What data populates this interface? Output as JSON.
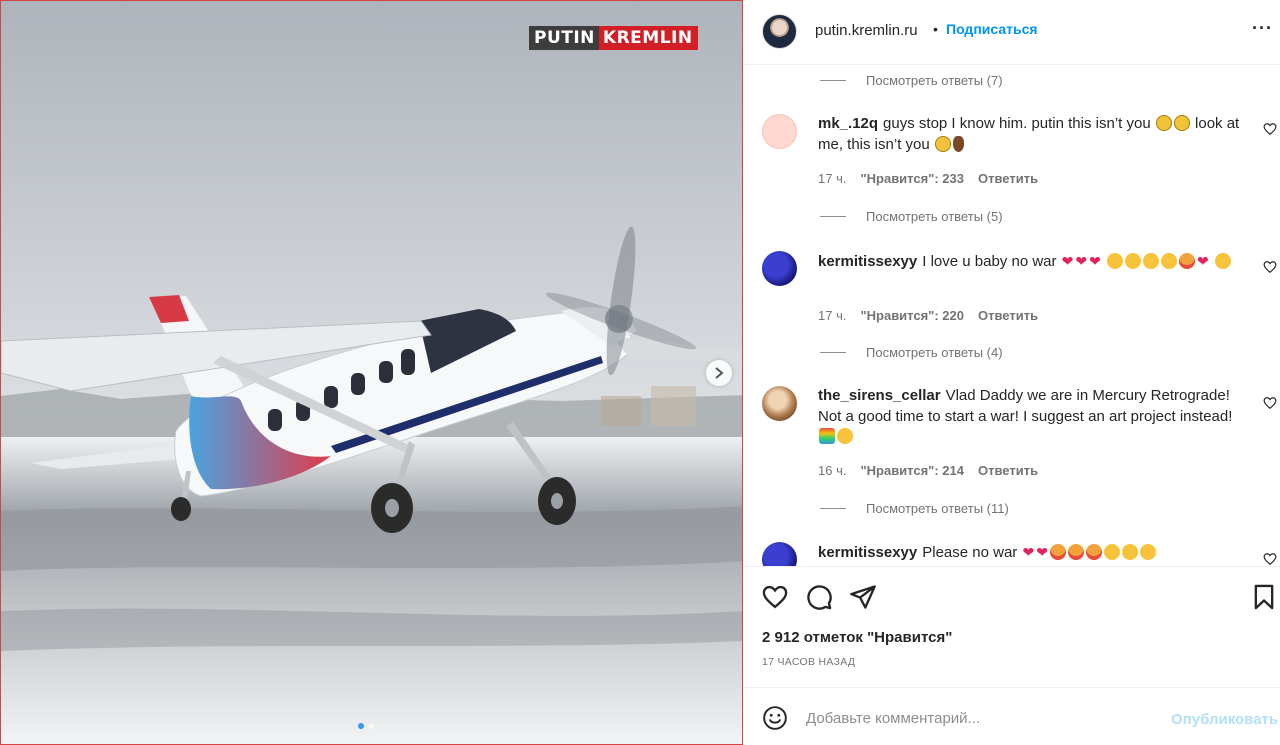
{
  "photo": {
    "watermark_left": "PUTIN",
    "watermark_right": "KREMLIN",
    "next_arrow": "chevron-right-icon",
    "carousel_dots": 2,
    "active_dot": 1
  },
  "header": {
    "username": "putin.kremlin.ru",
    "separator": "•",
    "follow_label": "Подписаться",
    "more_label": "···"
  },
  "comments": [
    {
      "username": "mk_.12q",
      "text": "guys stop I know him. putin this isn’t you",
      "text2": "look at me, this isn’t you",
      "time": "17 ч.",
      "likes": "\"Нравится\": 233",
      "reply_label": "Ответить",
      "view_replies": "Посмотреть ответы (5)"
    },
    {
      "username": "kermitissexyy",
      "text": "I love u baby no war",
      "time": "17 ч.",
      "likes": "\"Нравится\": 220",
      "reply_label": "Ответить",
      "view_replies": "Посмотреть ответы (4)"
    },
    {
      "username": "the_sirens_cellar",
      "text": "Vlad Daddy we are in Mercury Retrograde! Not a good time to start a war! I suggest an art project instead!",
      "time": "16 ч.",
      "likes": "\"Нравится\": 214",
      "reply_label": "Ответить",
      "view_replies": "Посмотреть ответы (11)"
    },
    {
      "username": "kermitissexyy",
      "text": "Please no war"
    }
  ],
  "top_view_replies": "Посмотреть ответы (7)",
  "actions": {
    "likes_total": "2 912 отметок \"Нравится\"",
    "time_ago": "17 ЧАСОВ НАЗАД"
  },
  "add_comment": {
    "placeholder": "Добавьте комментарий...",
    "publish_label": "Опубликовать"
  },
  "colors": {
    "accent": "#0095f6",
    "publish_disabled": "#b2dffc",
    "border": "#efefef",
    "watermark_red": "#d21f27"
  }
}
